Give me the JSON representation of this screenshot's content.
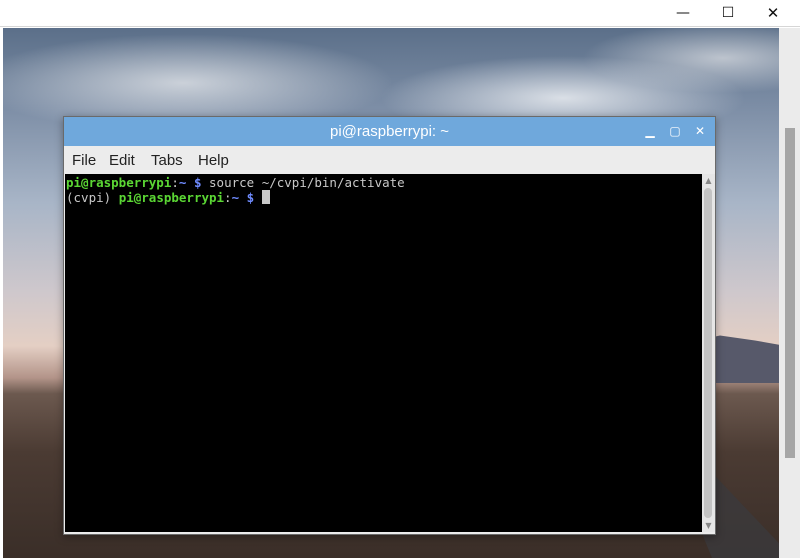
{
  "host_window": {
    "controls": {
      "minimize": "—",
      "maximize": "☐",
      "close": "✕"
    }
  },
  "terminal": {
    "title": "pi@raspberrypi: ~",
    "controls": {
      "minimize": "▁",
      "maximize": "▢",
      "close": "✕"
    },
    "menu": {
      "file": "File",
      "edit": "Edit",
      "tabs": "Tabs",
      "help": "Help"
    },
    "lines": [
      {
        "user": "pi@raspberrypi",
        "sep": ":",
        "path": "~",
        "dollar": "$",
        "command": "source ~/cvpi/bin/activate"
      },
      {
        "venv": "(cvpi)",
        "user": "pi@raspberrypi",
        "sep": ":",
        "path": "~",
        "dollar": "$",
        "command": ""
      }
    ],
    "scroll": {
      "up_icon": "▲",
      "down_icon": "▼"
    }
  },
  "colors": {
    "titlebar": "#6fa8dc",
    "prompt_user": "#5bd734",
    "prompt_path": "#6f8bff",
    "screen_bg": "#000000"
  }
}
